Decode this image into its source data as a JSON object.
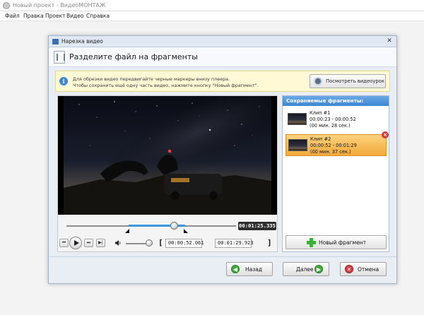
{
  "app": {
    "title": "Новый проект - ВидеоМОНТАЖ",
    "menu": [
      "Файл",
      "Правка",
      "Проект",
      "Видео",
      "Справка"
    ]
  },
  "dialog": {
    "window_title": "Нарезка видео",
    "close_glyph": "✕",
    "header_title": "Разделите файл на фрагменты",
    "tip_icon": "i",
    "tip_lines": [
      "Для обрезки видео передвигайте черные маркеры внизу плеера.",
      "Чтобы сохранить ещё одну часть видео, нажмите кнопку \"Новый фрагмент\"."
    ],
    "tutorial_button": "Посмотреть видеоурок"
  },
  "player": {
    "current_time": "00:01:25.335",
    "start_time": "00:00:52.061",
    "end_time": "00:01:29.923",
    "bracket_open": "[",
    "bracket_close": "]",
    "selection_start_fraction": 0.367,
    "selection_end_fraction": 0.7,
    "playhead_fraction": 0.633,
    "volume_fraction": 0.85
  },
  "fragments": {
    "header": "Сохраняемые фрагменты:",
    "clips": [
      {
        "name": "Клип #1",
        "range": "00:00:23 - 00:00:52",
        "duration": "(00 мин. 28 сек.)",
        "selected": false
      },
      {
        "name": "Клип #2",
        "range": "00:00:52 - 00:01:29",
        "duration": "(00 мин. 37 сек.)",
        "selected": true
      }
    ],
    "delete_glyph": "×",
    "new_fragment_button": "Новый фрагмент"
  },
  "footer": {
    "back": "Назад",
    "next": "Далее",
    "cancel": "Отмена",
    "back_glyph": "◀",
    "next_glyph": "▶",
    "cancel_glyph": "✕"
  },
  "colors": {
    "accent": "#3c86d2",
    "selected_clip": "#f3a93b",
    "timeline_selection": "#3a95df"
  }
}
